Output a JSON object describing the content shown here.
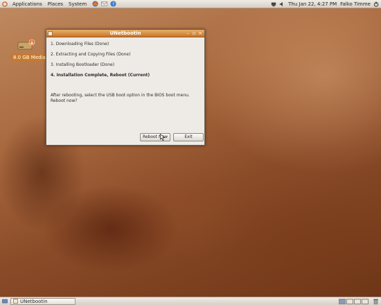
{
  "top_panel": {
    "menus": [
      "Applications",
      "Places",
      "System"
    ],
    "clock": "Thu Jan 22,  4:27 PM",
    "user": "Falko Timme"
  },
  "desktop": {
    "icon_label": "8.0 GB Media"
  },
  "window": {
    "title": "UNetbootin",
    "steps": [
      "1. Downloading Files (Done)",
      "2. Extracting and Copying Files (Done)",
      "3. Installing Bootloader (Done)",
      "4. Installation Complete, Reboot (Current)"
    ],
    "message_line1": "After rebooting, select the USB boot option in the BIOS boot menu.",
    "message_line2": "Reboot now?",
    "reboot_label": "Reboot Now",
    "exit_label": "Exit"
  },
  "bottom_panel": {
    "task_label": "UNetbootin"
  },
  "colors": {
    "titlebar": "#c8742a",
    "panel": "#d6d0c6",
    "drive_label_bg": "#c87a2c"
  }
}
